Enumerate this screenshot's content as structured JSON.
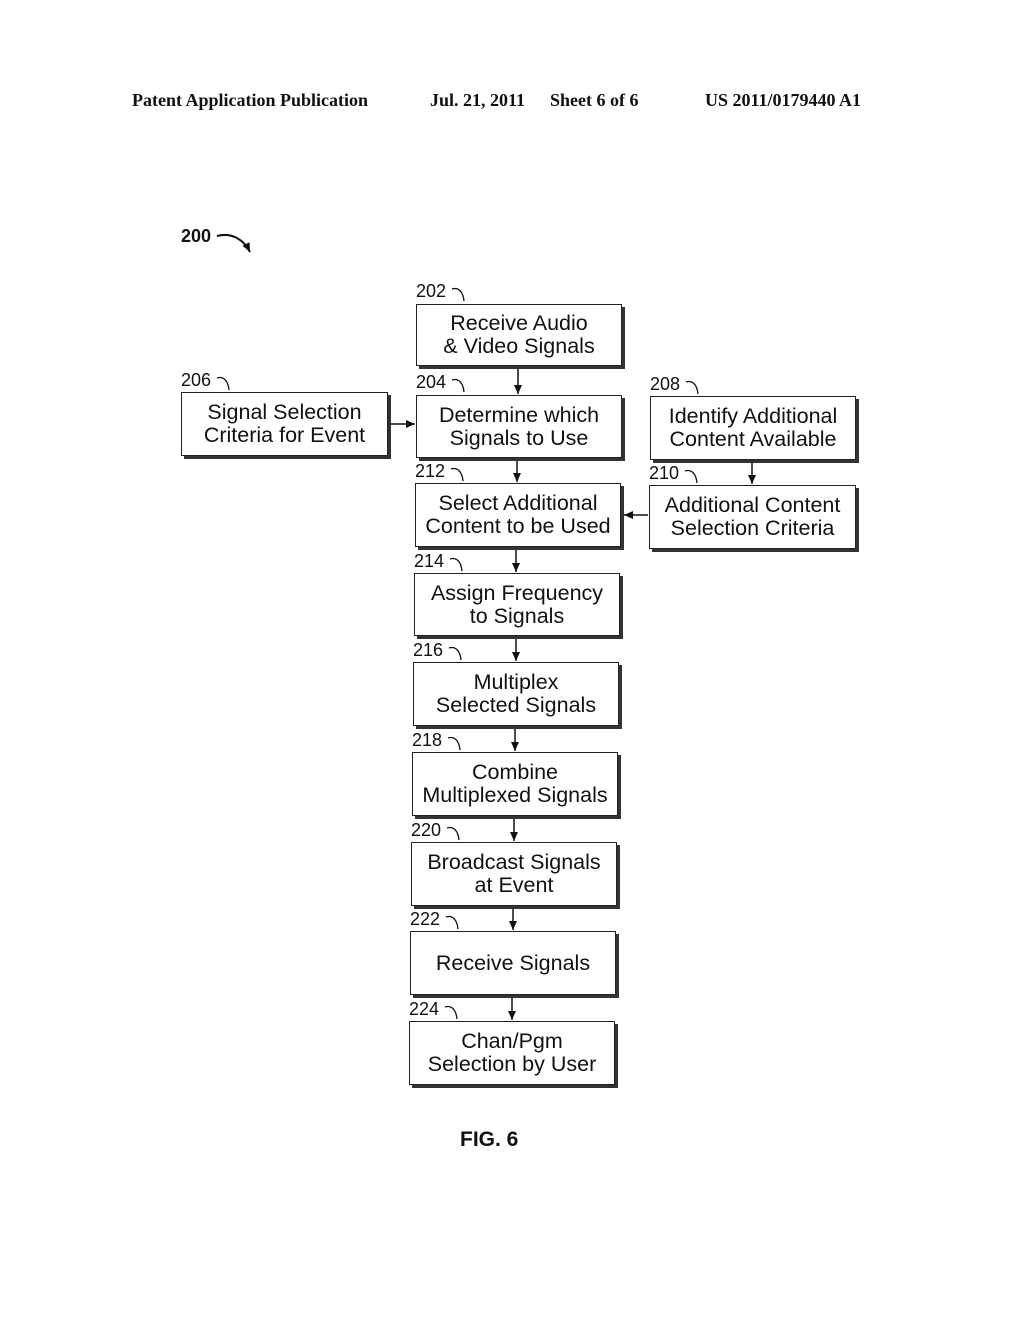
{
  "header": {
    "publication": "Patent Application Publication",
    "date": "Jul. 21, 2011",
    "sheet": "Sheet 6 of 6",
    "number": "US 2011/0179440 A1"
  },
  "figure": {
    "ref_label": "200",
    "caption": "FIG. 6"
  },
  "steps": {
    "s202": {
      "ref": "202",
      "text": "Receive Audio\n& Video Signals"
    },
    "s204": {
      "ref": "204",
      "text": "Determine which\nSignals to Use"
    },
    "s206": {
      "ref": "206",
      "text": "Signal Selection\nCriteria for Event"
    },
    "s208": {
      "ref": "208",
      "text": "Identify Additional\nContent Available"
    },
    "s210": {
      "ref": "210",
      "text": "Additional Content\nSelection Criteria"
    },
    "s212": {
      "ref": "212",
      "text": "Select Additional\nContent to be Used"
    },
    "s214": {
      "ref": "214",
      "text": "Assign Frequency\nto Signals"
    },
    "s216": {
      "ref": "216",
      "text": "Multiplex\nSelected Signals"
    },
    "s218": {
      "ref": "218",
      "text": "Combine\nMultiplexed Signals"
    },
    "s220": {
      "ref": "220",
      "text": "Broadcast Signals\nat Event"
    },
    "s222": {
      "ref": "222",
      "text": "Receive Signals"
    },
    "s224": {
      "ref": "224",
      "text": "Chan/Pgm\nSelection by User"
    }
  },
  "flow": [
    {
      "from": "202",
      "to": "204"
    },
    {
      "from": "206",
      "to": "204"
    },
    {
      "from": "204",
      "to": "212"
    },
    {
      "from": "208",
      "to": "210"
    },
    {
      "from": "210",
      "to": "212"
    },
    {
      "from": "212",
      "to": "214"
    },
    {
      "from": "214",
      "to": "216"
    },
    {
      "from": "216",
      "to": "218"
    },
    {
      "from": "218",
      "to": "220"
    },
    {
      "from": "220",
      "to": "222"
    },
    {
      "from": "222",
      "to": "224"
    }
  ]
}
